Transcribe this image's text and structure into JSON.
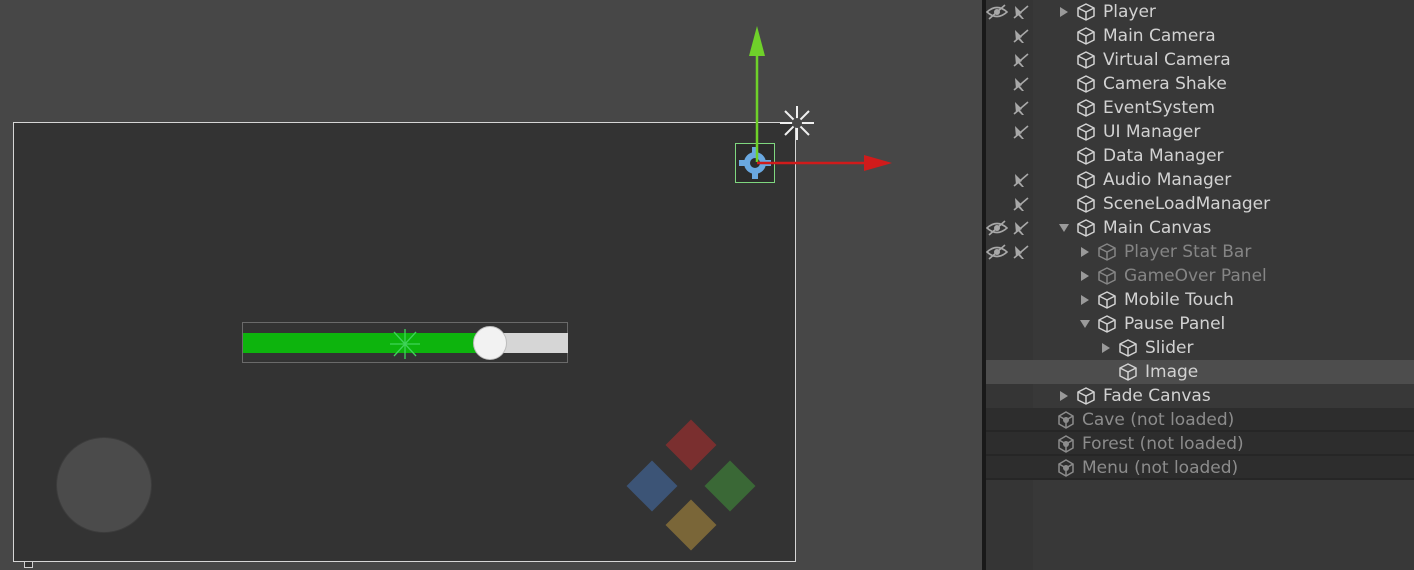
{
  "scene": {
    "slider_value": 0.76,
    "colors": {
      "slider_fill": "#0db40d",
      "slider_track": "#d6d6d6",
      "dpad_up": "#7a2f2f",
      "dpad_left": "#3c5476",
      "dpad_right": "#3a6836",
      "dpad_down": "#7a6638",
      "gizmo_y": "#6fd12a",
      "gizmo_x": "#d01b1b"
    }
  },
  "hierarchy": {
    "items": [
      {
        "label": "Player",
        "expand": "collapsed",
        "vis": true,
        "pick": true,
        "dim": false
      },
      {
        "label": "Main Camera",
        "expand": "none",
        "vis": false,
        "pick": true,
        "dim": false
      },
      {
        "label": "Virtual Camera",
        "expand": "none",
        "vis": false,
        "pick": true,
        "dim": false
      },
      {
        "label": "Camera Shake",
        "expand": "none",
        "vis": false,
        "pick": true,
        "dim": false
      },
      {
        "label": "EventSystem",
        "expand": "none",
        "vis": false,
        "pick": true,
        "dim": false
      },
      {
        "label": "UI Manager",
        "expand": "none",
        "vis": false,
        "pick": true,
        "dim": false
      },
      {
        "label": "Data Manager",
        "expand": "none",
        "vis": false,
        "pick": false,
        "dim": false
      },
      {
        "label": "Audio Manager",
        "expand": "none",
        "vis": false,
        "pick": true,
        "dim": false
      },
      {
        "label": "SceneLoadManager",
        "expand": "none",
        "vis": false,
        "pick": true,
        "dim": false
      },
      {
        "label": "Main Canvas",
        "expand": "expanded",
        "vis": true,
        "pick": true,
        "dim": false
      },
      {
        "label": "Player Stat Bar",
        "expand": "collapsed",
        "vis": true,
        "pick": true,
        "dim": true
      },
      {
        "label": "GameOver Panel",
        "expand": "collapsed",
        "vis": false,
        "pick": false,
        "dim": true
      },
      {
        "label": "Mobile Touch",
        "expand": "collapsed",
        "vis": false,
        "pick": false,
        "dim": false
      },
      {
        "label": "Pause Panel",
        "expand": "expanded",
        "vis": false,
        "pick": false,
        "dim": false
      },
      {
        "label": "Slider",
        "expand": "collapsed",
        "vis": false,
        "pick": false,
        "dim": false
      },
      {
        "label": "Image",
        "expand": "none",
        "vis": false,
        "pick": false,
        "dim": false,
        "selected": true
      },
      {
        "label": "Fade Canvas",
        "expand": "collapsed",
        "vis": false,
        "pick": false,
        "dim": false
      }
    ],
    "scenes": [
      {
        "label": "Cave (not loaded)"
      },
      {
        "label": "Forest (not loaded)"
      },
      {
        "label": "Menu (not loaded)"
      }
    ],
    "icons": {
      "cube": "gameobject-cube-icon",
      "scene": "unity-scene-icon",
      "vis": "eye-hidden-icon",
      "pick": "pick-disabled-icon",
      "arrow": "fold-arrow-icon"
    }
  }
}
